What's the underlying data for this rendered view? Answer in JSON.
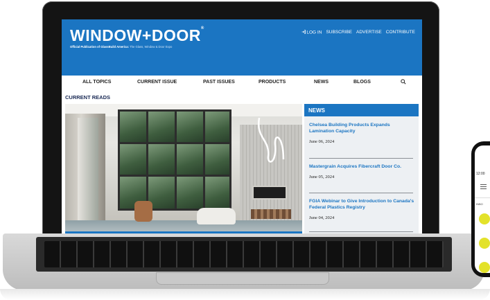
{
  "site": {
    "logo_text": "WINDOW+DOOR",
    "logo_mark": "®",
    "tagline_bold": "Official Publication of GlassBuild America:",
    "tagline_rest": " The Glass, Window & Door Expo",
    "top_links": [
      "LOG IN",
      "SUBSCRIBE",
      "ADVERTISE",
      "CONTRIBUTE"
    ]
  },
  "nav": {
    "items": [
      "ALL TOPICS",
      "CURRENT ISSUE",
      "PAST ISSUES",
      "PRODUCTS",
      "NEWS",
      "BLOGS"
    ]
  },
  "main": {
    "section_title": "CURRENT READS"
  },
  "news": {
    "heading": "NEWS",
    "items": [
      {
        "title": "Chelsea Building Products Expands Lamination Capacity",
        "date": "June 06, 2024"
      },
      {
        "title": "Mastergrain Acquires Fibercraft Door Co.",
        "date": "June 05, 2024"
      },
      {
        "title": "FGIA Webinar to Give Introduction to Canada's Federal Plastics Registry",
        "date": "June 04, 2024"
      }
    ]
  },
  "phone": {
    "time": "12:00",
    "label": "INBO"
  },
  "colors": {
    "brand_blue": "#1b75c2",
    "phone_dot": "#e3e22a"
  },
  "icons": [
    "login-icon",
    "search-icon",
    "menu-icon"
  ]
}
